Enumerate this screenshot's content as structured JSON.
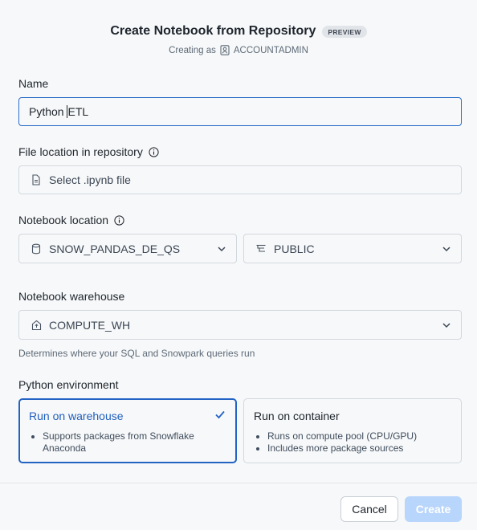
{
  "header": {
    "title": "Create Notebook from Repository",
    "badge": "PREVIEW",
    "subtitle_prefix": "Creating as",
    "role": "ACCOUNTADMIN"
  },
  "name_field": {
    "label": "Name",
    "value_before_caret": "Python ",
    "value_after_caret": "ETL"
  },
  "file_location": {
    "label": "File location in repository",
    "placeholder": "Select .ipynb file"
  },
  "notebook_location": {
    "label": "Notebook location",
    "database": "SNOW_PANDAS_DE_QS",
    "schema": "PUBLIC"
  },
  "warehouse": {
    "label": "Notebook warehouse",
    "value": "COMPUTE_WH",
    "helper": "Determines where your SQL and Snowpark queries run"
  },
  "python_env": {
    "label": "Python environment",
    "options": [
      {
        "title": "Run on warehouse",
        "bullets": [
          "Supports packages from Snowflake Anaconda"
        ],
        "selected": true
      },
      {
        "title": "Run on container",
        "bullets": [
          "Runs on compute pool (CPU/GPU)",
          "Includes more package sources"
        ],
        "selected": false
      }
    ]
  },
  "footer": {
    "cancel_label": "Cancel",
    "create_label": "Create"
  },
  "colors": {
    "accent": "#2263c4",
    "create_disabled": "#b8d5fb",
    "background": "#f7f8f9"
  }
}
